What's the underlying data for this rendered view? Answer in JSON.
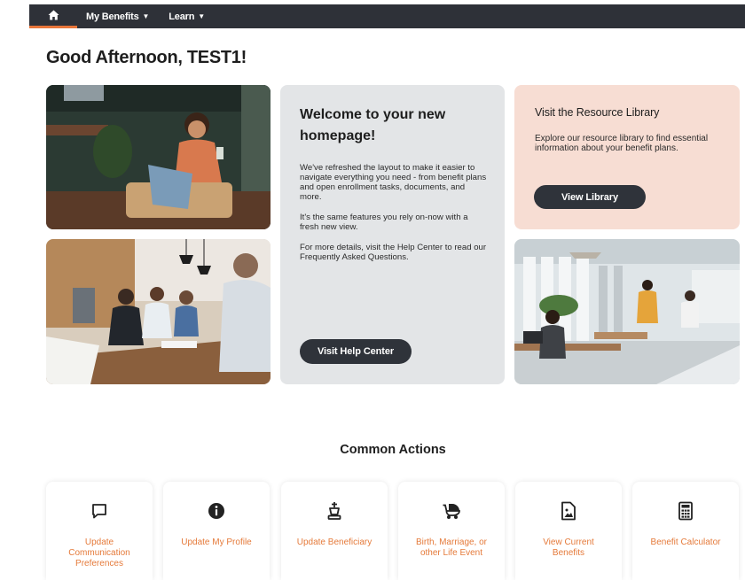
{
  "nav": {
    "home_icon": "home-icon",
    "items": [
      {
        "label": "My Benefits"
      },
      {
        "label": "Learn"
      }
    ]
  },
  "greeting": "Good Afternoon, TEST1!",
  "welcome": {
    "title": "Welcome to your new homepage!",
    "paragraphs": [
      "We've refreshed the layout to make it easier to navigate everything you need - from benefit plans and open enrollment tasks, documents, and more.",
      "It's the same features you rely on-now with a fresh new view.",
      "For more details, visit the Help Center to read our Frequently Asked Questions."
    ],
    "button": "Visit Help Center"
  },
  "resource": {
    "title": "Visit the Resource Library",
    "text": "Explore our resource library to find essential information about your benefit plans.",
    "button": "View Library"
  },
  "common_actions": {
    "title": "Common Actions",
    "items": [
      {
        "label": "Update Communication Preferences",
        "icon": "speech-bubble-icon"
      },
      {
        "label": "Update My Profile",
        "icon": "info-icon"
      },
      {
        "label": "Update Beneficiary",
        "icon": "chess-king-icon"
      },
      {
        "label": "Birth, Marriage, or other Life Event",
        "icon": "baby-stroller-icon"
      },
      {
        "label": "View Current Benefits",
        "icon": "image-document-icon"
      },
      {
        "label": "Benefit Calculator",
        "icon": "calculator-icon"
      }
    ]
  },
  "colors": {
    "nav_bg": "#2e3138",
    "accent": "#e57a3a",
    "welcome_bg": "#e3e5e7",
    "resource_bg": "#f7ddd3",
    "button_bg": "#2f333a"
  }
}
